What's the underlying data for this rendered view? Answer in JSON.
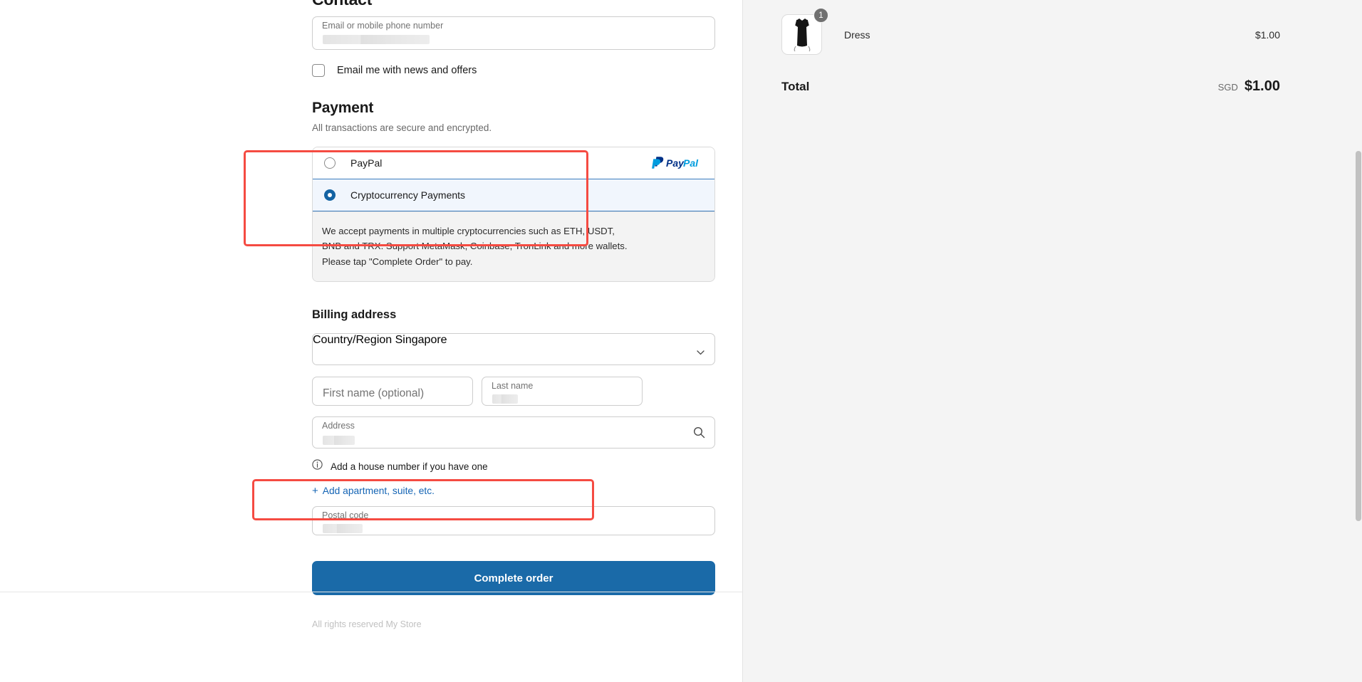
{
  "contact": {
    "title": "Contact",
    "email_placeholder": "Email or mobile phone number",
    "email_value": "",
    "newsletter_label": "Email me with news and offers"
  },
  "payment": {
    "title": "Payment",
    "subtitle": "All transactions are secure and encrypted.",
    "methods": [
      {
        "label": "PayPal",
        "selected": false,
        "logo": "paypal-logo"
      },
      {
        "label": "Cryptocurrency Payments",
        "selected": true
      }
    ],
    "crypto_description": "We accept payments in multiple cryptocurrencies such as ETH, USDT, BNB and TRX. Support MetaMask, Coinbase, TronLink and more wallets. Please tap \"Complete Order\" to pay.",
    "paypal_brand": {
      "pay": "Pay",
      "pal": "Pal"
    }
  },
  "billing": {
    "title": "Billing address",
    "country_label": "Country/Region",
    "country_value": "Singapore",
    "first_name_placeholder": "First name (optional)",
    "last_name_label": "Last name",
    "address_label": "Address",
    "house_number_hint": "Add a house number if you have one",
    "add_apartment_link": "Add apartment, suite, etc.",
    "postal_label": "Postal code"
  },
  "actions": {
    "complete_order": "Complete order"
  },
  "footer": {
    "text": "All rights reserved My Store"
  },
  "summary": {
    "items": [
      {
        "name": "Dress",
        "qty": "1",
        "price": "$1.00"
      }
    ],
    "total_label": "Total",
    "currency": "SGD",
    "total_amount": "$1.00"
  },
  "colors": {
    "accent": "#1a6aa8",
    "annotation": "#f54b42",
    "selected_bg": "#f1f6fd",
    "selected_border": "#3b7cbf",
    "link": "#1565b5"
  }
}
